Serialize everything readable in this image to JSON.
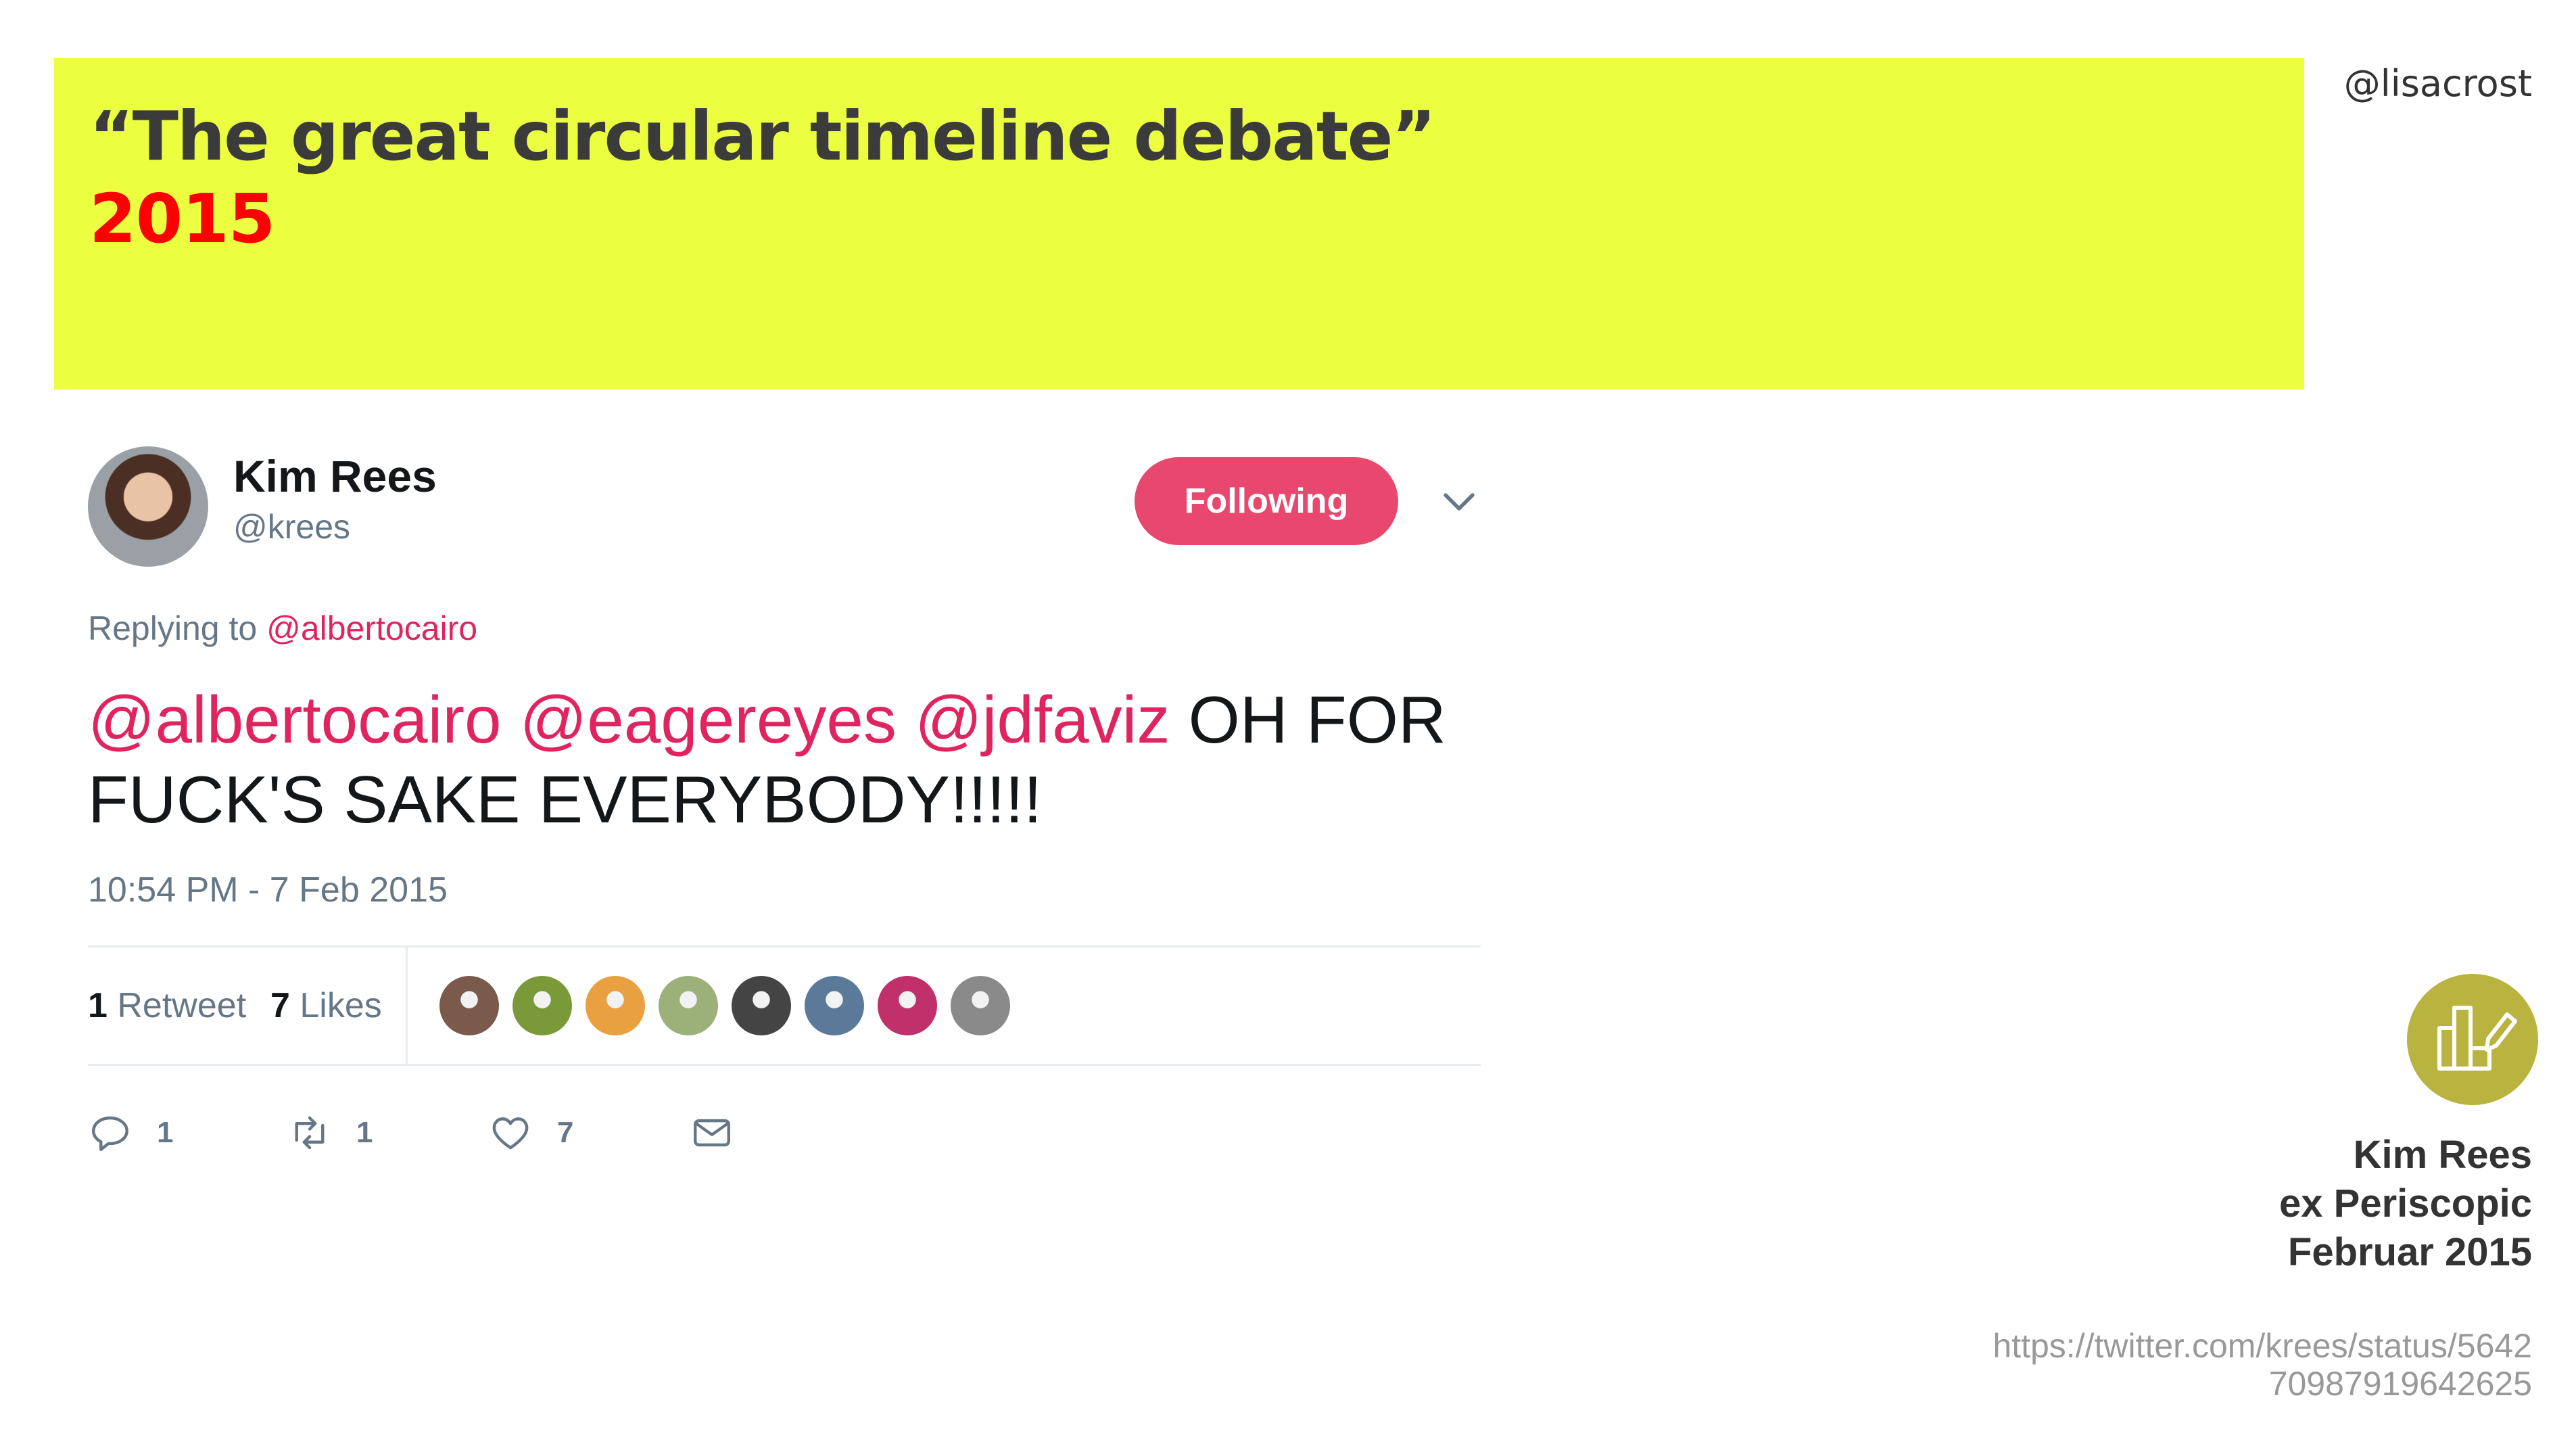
{
  "slide": {
    "title": "“The great circular timeline debate”",
    "year": "2015",
    "handle": "@lisacrost",
    "banner_color": "#ebff40",
    "year_color": "#ff0000"
  },
  "tweet": {
    "author_name": "Kim Rees",
    "author_handle": "@krees",
    "follow_label": "Following",
    "reply_prefix": "Replying to",
    "reply_mention": "@albertocairo",
    "mentions": [
      "@albertocairo",
      "@eagereyes",
      "@jdfaviz"
    ],
    "text": "OH FOR FUCK'S SAKE EVERYBODY!!!!!",
    "timestamp": "10:54 PM - 7 Feb 2015",
    "retweet_count": "1",
    "retweet_label": "Retweet",
    "like_count": "7",
    "like_label": "Likes",
    "likers": [
      {
        "name": "liker-1",
        "color": "#7a5a4a"
      },
      {
        "name": "liker-2",
        "color": "#7a9a3a"
      },
      {
        "name": "liker-3",
        "color": "#e8a040"
      },
      {
        "name": "liker-4",
        "color": "#9cb07a"
      },
      {
        "name": "liker-5",
        "color": "#444444"
      },
      {
        "name": "liker-6",
        "color": "#5b7a9a"
      },
      {
        "name": "liker-7",
        "color": "#c0306a"
      },
      {
        "name": "liker-8",
        "color": "#8a8a8a"
      }
    ],
    "actions": {
      "reply_count": "1",
      "retweet_count": "1",
      "like_count": "7"
    },
    "accent_color": "#e0245e",
    "button_color": "#e8486d"
  },
  "credit": {
    "name": "Kim Rees",
    "role": "ex Periscopic",
    "date": "Februar 2015",
    "url": "https://twitter.com/krees/status/564270987919642625",
    "logo_color": "#b8b43f"
  }
}
